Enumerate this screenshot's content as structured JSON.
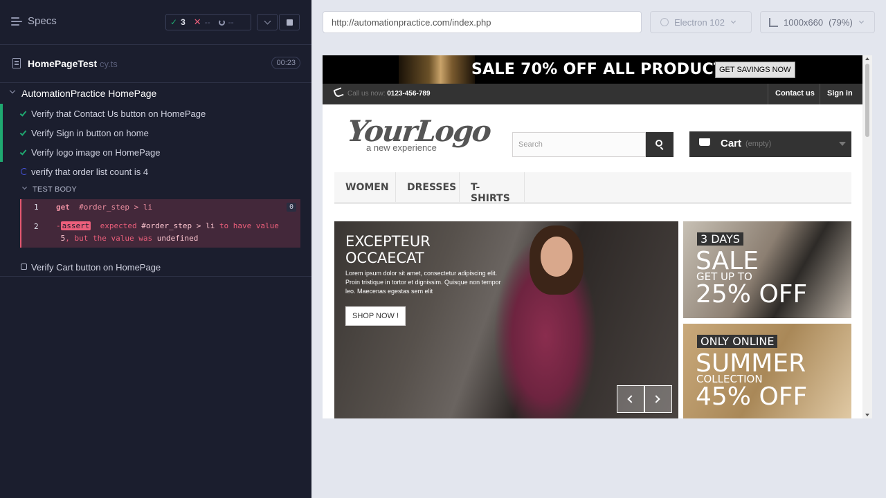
{
  "reporter": {
    "specs_label": "Specs",
    "stats": {
      "passed": "3",
      "failed": "--",
      "pending": "--"
    },
    "spec_file": {
      "name": "HomePageTest",
      "ext": "cy.ts",
      "duration": "00:23"
    },
    "suite": "AutomationPractice HomePage",
    "tests": [
      {
        "label": "Verify that Contact Us button on HomePage",
        "state": "passed"
      },
      {
        "label": "Verify Sign in button on home",
        "state": "passed"
      },
      {
        "label": "Verify logo image on HomePage",
        "state": "passed"
      },
      {
        "label": "verify that order list count is 4",
        "state": "running"
      },
      {
        "label": "Verify Cart button on HomePage",
        "state": "pending"
      }
    ],
    "test_body_label": "TEST BODY",
    "commands": [
      {
        "num": "1",
        "name": "get",
        "selector": "#order_step > li",
        "badge": "0"
      },
      {
        "num": "2",
        "prefix": "-",
        "name": "assert",
        "t1": "expected",
        "t2": "#order_step > li",
        "t3": "to have value",
        "t4": "5",
        "t5": ", but the value was",
        "t6": "undefined"
      }
    ]
  },
  "browser": {
    "url": "http://automationpractice.com/index.php",
    "engine": "Electron 102",
    "viewport": "1000x660",
    "zoom": "(79%)"
  },
  "site": {
    "promo_text": "SALE 70% OFF ALL PRODUCTS",
    "promo_button": "GET SAVINGS NOW",
    "call_label": "Call us now:",
    "phone": "0123-456-789",
    "contact_link": "Contact us",
    "signin_link": "Sign in",
    "logo_main": "YourLogo",
    "logo_sub": "a new experience",
    "search_placeholder": "Search",
    "cart_label": "Cart",
    "cart_empty": "(empty)",
    "menu": [
      "WOMEN",
      "DRESSES",
      "T-SHIRTS"
    ],
    "slide": {
      "title_line1": "EXCEPTEUR",
      "title_line2": "OCCAECAT",
      "text": "Lorem ipsum dolor sit amet, consectetur adipiscing elit. Proin tristique in tortor et dignissim. Quisque non tempor leo. Maecenas egestas sem elit",
      "button": "SHOP NOW !"
    },
    "banner1": {
      "tag": "3 DAYS",
      "big": "SALE",
      "mid": "GET UP TO",
      "pct": "25% OFF"
    },
    "banner2": {
      "tag": "ONLY ONLINE",
      "big": "SUMMER",
      "mid": "COLLECTION",
      "pct": "45% OFF"
    }
  },
  "colors": {
    "reporter_bg": "#1b1e2e",
    "pass": "#1fa971",
    "fail": "#ec5f7b",
    "running": "#4956e3"
  }
}
